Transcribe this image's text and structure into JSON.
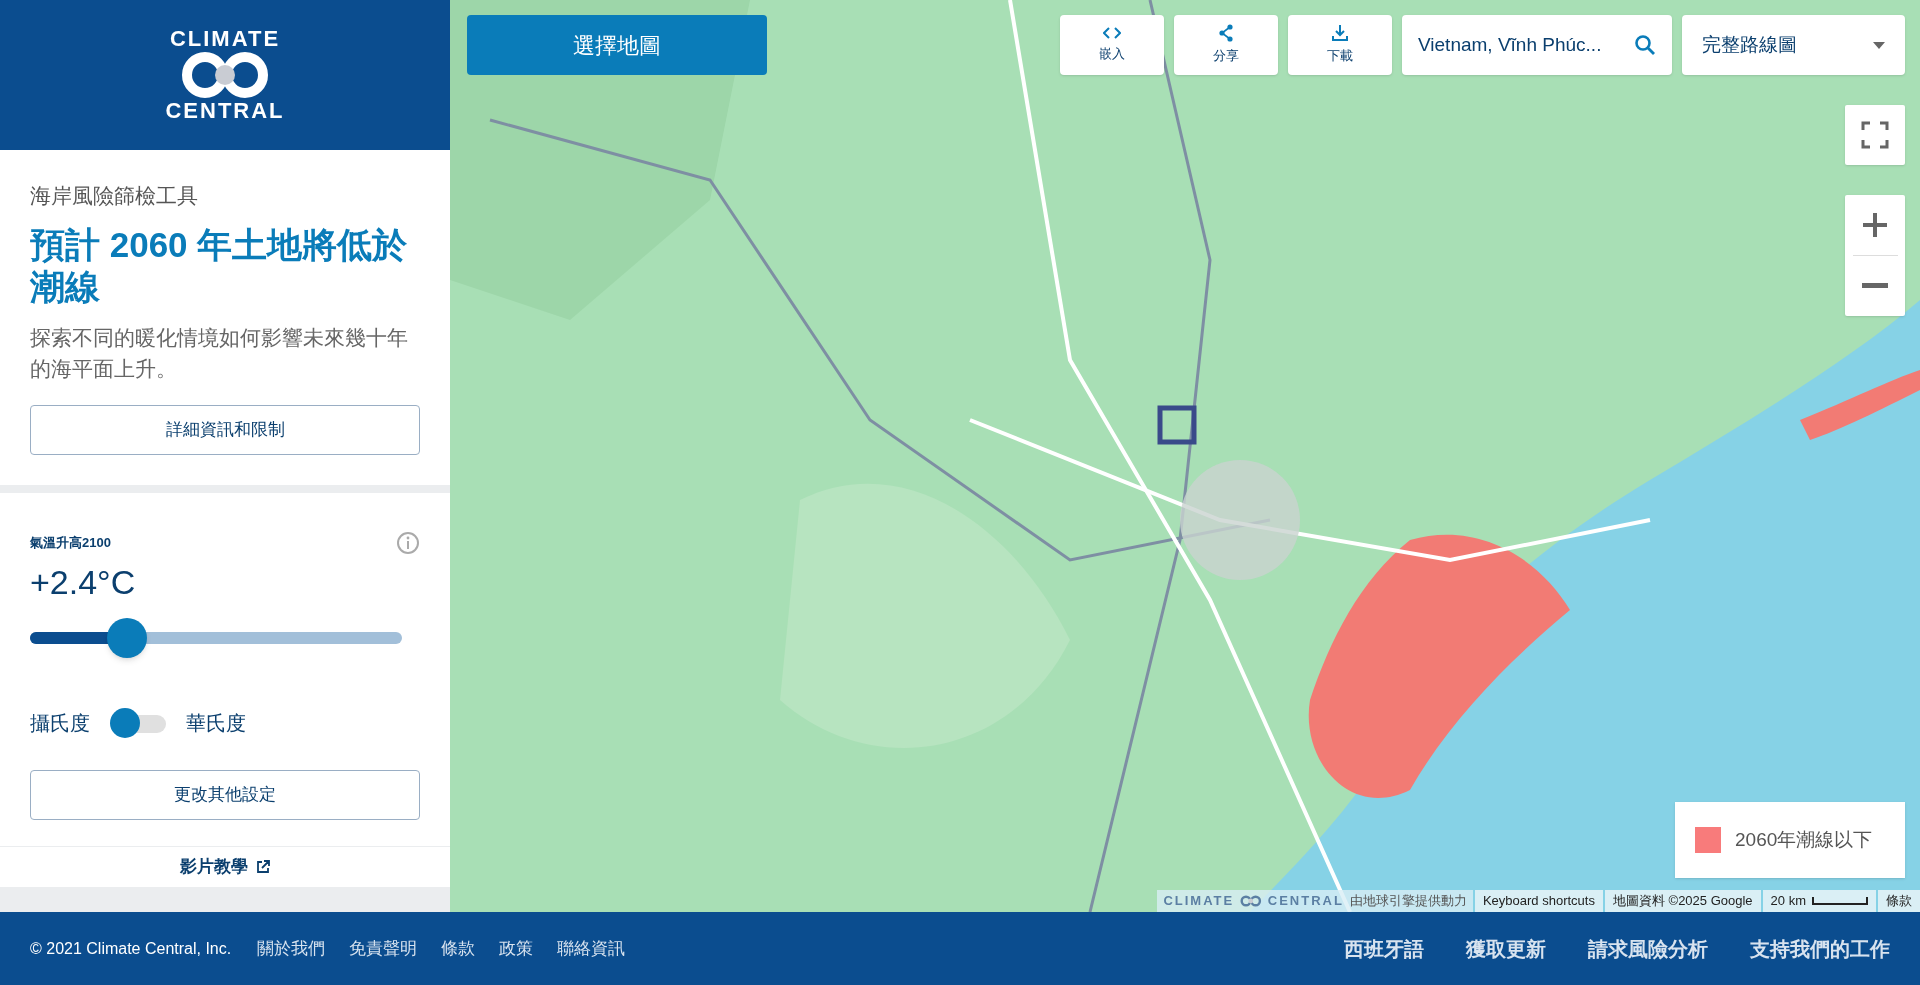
{
  "sidebar": {
    "logo": {
      "top": "CLIMATE",
      "bottom": "CENTRAL"
    },
    "intro": {
      "eyebrow": "海岸風險篩檢工具",
      "title": "預計 2060 年土地將低於潮線",
      "description": "探索不同的暖化情境如何影響未來幾十年的海平面上升。",
      "button": "詳細資訊和限制"
    },
    "settings": {
      "label": "氣溫升高2100",
      "reading": "+2.4°C",
      "slider": {
        "level": 0.26
      },
      "unit_toggle": {
        "left": "攝氏度",
        "right": "華氏度",
        "on": false
      },
      "button": "更改其他設定"
    },
    "video_link": "影片教學"
  },
  "map": {
    "select_button": "選擇地圖",
    "tools": [
      {
        "kind": "embed",
        "label": "嵌入"
      },
      {
        "kind": "share",
        "label": "分享"
      },
      {
        "kind": "download",
        "label": "下載"
      }
    ],
    "search": {
      "value": "Vietnam, Vĩnh Phúc..."
    },
    "layer_select": {
      "value": "完整路線圖"
    },
    "legend": {
      "label": "2060年潮線以下",
      "color": "#f87b7b"
    },
    "attribution": {
      "logo_left": "CLIMATE",
      "logo_right": "CENTRAL",
      "powered": "由地球引擎提供動力",
      "items": [
        "Keyboard shortcuts",
        "地圖資料 ©2025 Google"
      ],
      "scale": "20 km",
      "terms": "條款"
    }
  },
  "footer": {
    "copyright": "© 2021 Climate Central, Inc.",
    "left_links": [
      "關於我們",
      "免責聲明",
      "條款",
      "政策",
      "聯絡資訊"
    ],
    "right_links": [
      "西班牙語",
      "獲取更新",
      "請求風險分析",
      "支持我們的工作"
    ]
  }
}
